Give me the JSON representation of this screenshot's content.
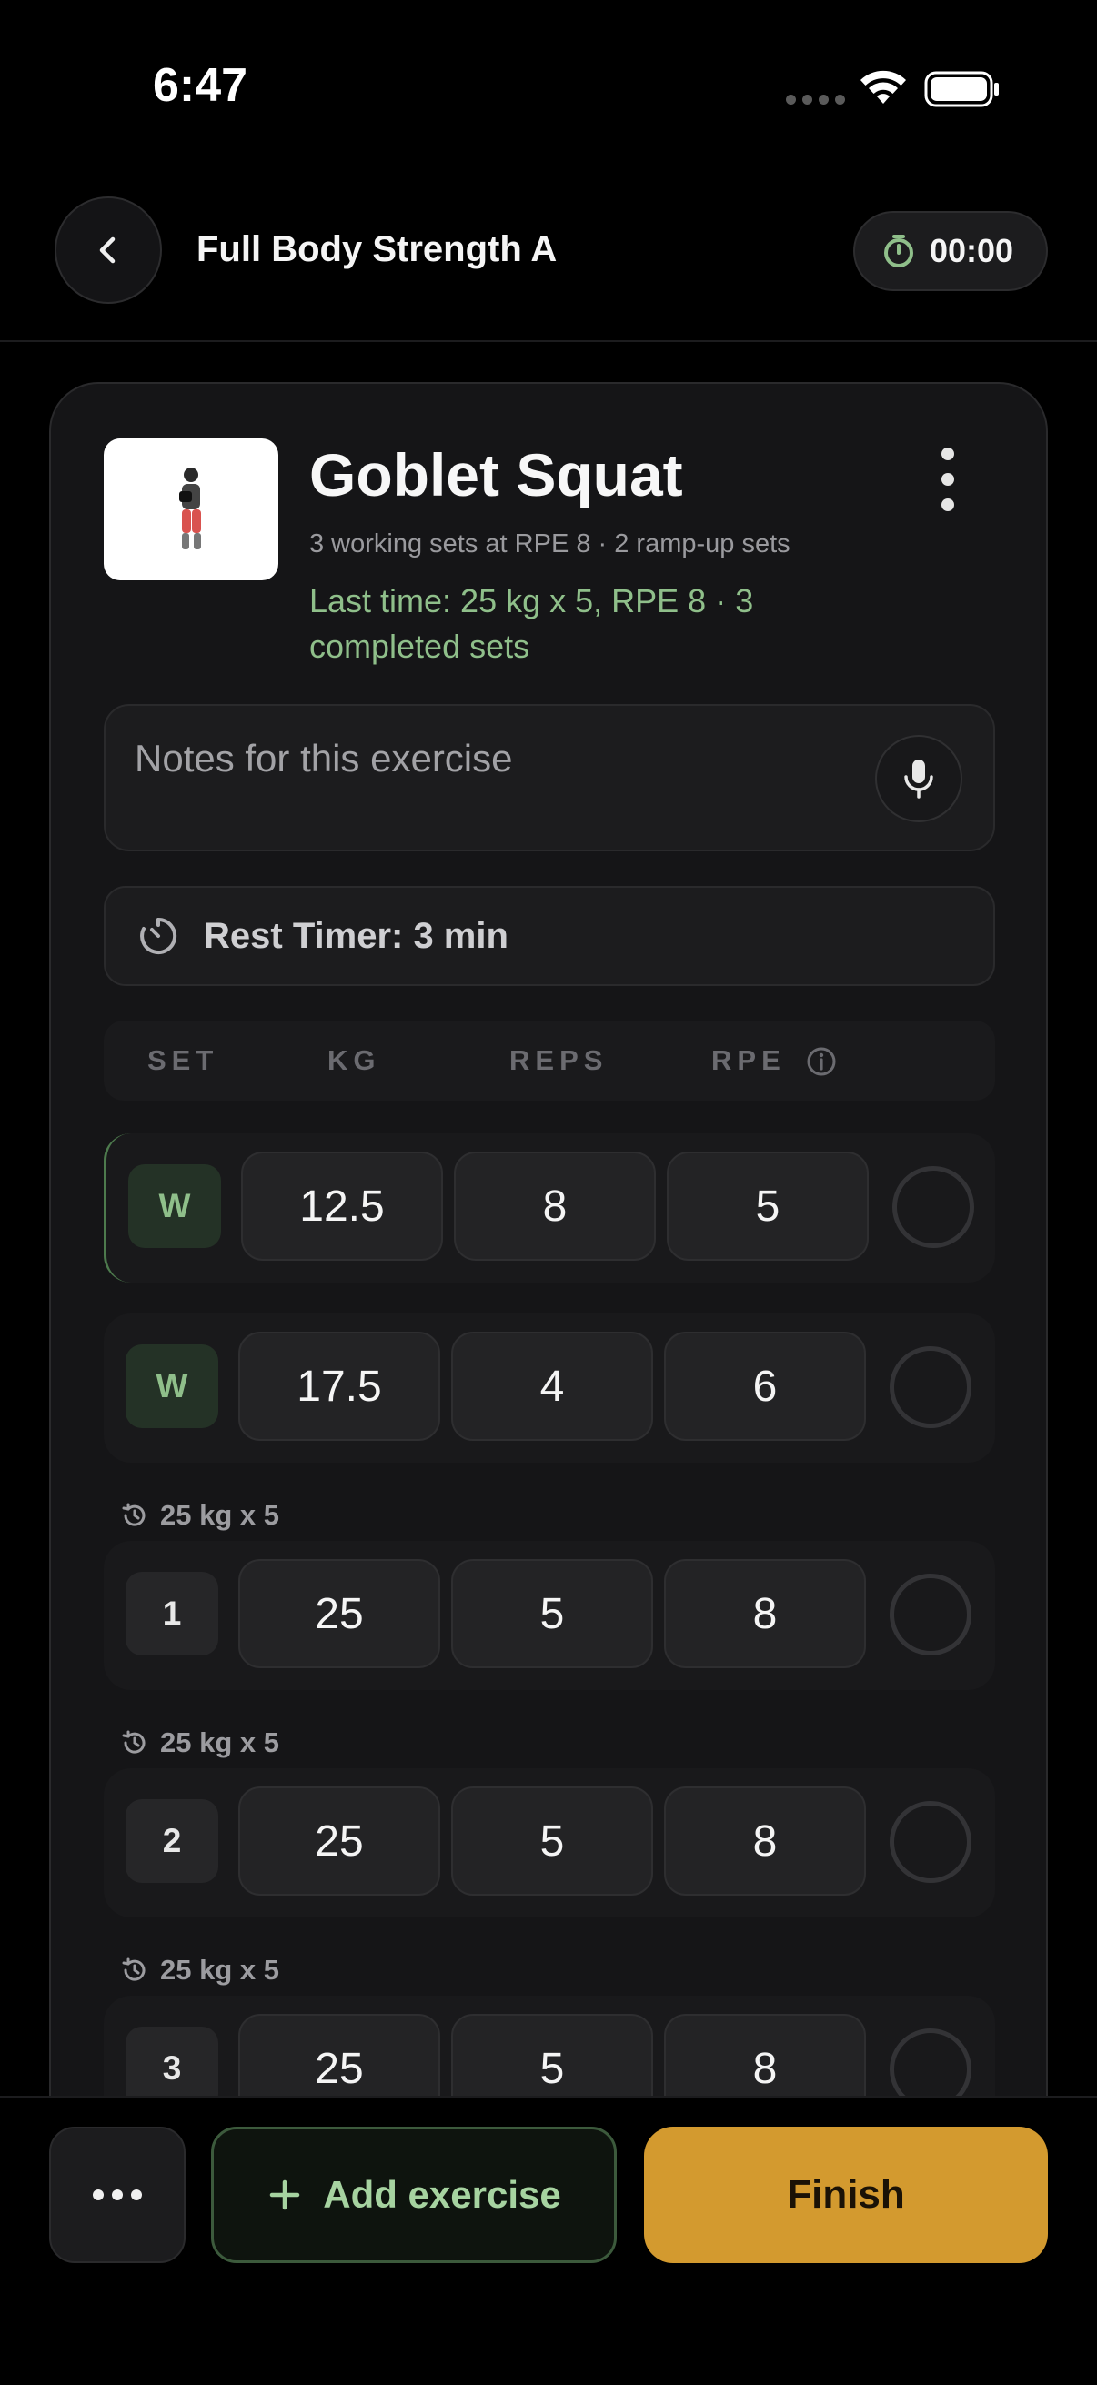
{
  "status_bar": {
    "time": "6:47"
  },
  "header": {
    "title": "Full Body Strength A",
    "timer": "00:00"
  },
  "exercise": {
    "name": "Goblet Squat",
    "subtitle": "3 working sets at RPE 8 · 2 ramp-up sets",
    "last_time": "Last time: 25 kg x 5, RPE 8 · 3 completed sets",
    "notes_placeholder": "Notes for this exercise",
    "rest_timer": "Rest Timer: 3 min"
  },
  "columns": {
    "set": "SET",
    "kg": "KG",
    "reps": "REPS",
    "rpe": "RPE"
  },
  "sets": [
    {
      "label": "W",
      "type": "warmup",
      "previous": "",
      "kg": "12.5",
      "reps": "8",
      "rpe": "5",
      "completed": false
    },
    {
      "label": "W",
      "type": "warmup",
      "previous": "",
      "kg": "17.5",
      "reps": "4",
      "rpe": "6",
      "completed": false
    },
    {
      "label": "1",
      "type": "working",
      "previous": "25 kg x 5",
      "kg": "25",
      "reps": "5",
      "rpe": "8",
      "completed": false
    },
    {
      "label": "2",
      "type": "working",
      "previous": "25 kg x 5",
      "kg": "25",
      "reps": "5",
      "rpe": "8",
      "completed": false
    },
    {
      "label": "3",
      "type": "working",
      "previous": "25 kg x 5",
      "kg": "25",
      "reps": "5",
      "rpe": "8",
      "completed": false
    }
  ],
  "bottom": {
    "add_exercise": "Add exercise",
    "finish": "Finish"
  },
  "colors": {
    "accent_green": "#8fbf8a",
    "finish_orange": "#d39a2f",
    "background": "#000000",
    "card": "#151517"
  }
}
